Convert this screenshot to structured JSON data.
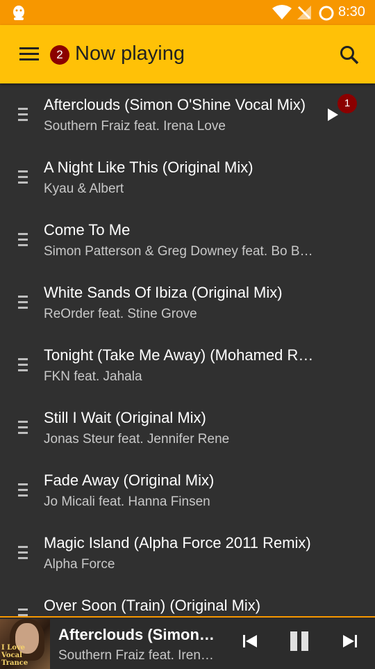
{
  "status_bar": {
    "time": "8:30"
  },
  "toolbar": {
    "badge": "2",
    "title": "Now playing"
  },
  "colors": {
    "status_bar": "#F79700",
    "toolbar": "#FFC107",
    "background": "#303030",
    "badge": "#8B0000"
  },
  "playlist": [
    {
      "title": "Afterclouds (Simon O'Shine Vocal Mix)",
      "artist": "Southern Fraiz feat. Irena Love",
      "playing": true,
      "badge": "1"
    },
    {
      "title": "A Night Like This (Original Mix)",
      "artist": "Kyau & Albert"
    },
    {
      "title": "Come To Me",
      "artist": "Simon Patterson & Greg Downey feat. Bo Bruce"
    },
    {
      "title": "White Sands Of Ibiza (Original Mix)",
      "artist": "ReOrder feat. Stine Grove"
    },
    {
      "title": "Tonight (Take Me Away) (Mohamed Ragab Remix)",
      "artist": "FKN feat. Jahala"
    },
    {
      "title": "Still I Wait (Original Mix)",
      "artist": "Jonas Steur feat. Jennifer Rene"
    },
    {
      "title": "Fade Away (Original Mix)",
      "artist": "Jo Micali feat. Hanna Finsen"
    },
    {
      "title": "Magic Island (Alpha Force 2011 Remix)",
      "artist": "Alpha Force"
    },
    {
      "title": "Over Soon (Train) (Original Mix)",
      "artist": ""
    }
  ],
  "now_playing": {
    "title": "Afterclouds (Simon O'Shine Vocal Mix)",
    "artist": "Southern Fraiz feat. Irena Love",
    "album_art_text": "I Love Vocal Trance",
    "controls": [
      "previous-icon",
      "pause-icon",
      "next-icon"
    ]
  }
}
